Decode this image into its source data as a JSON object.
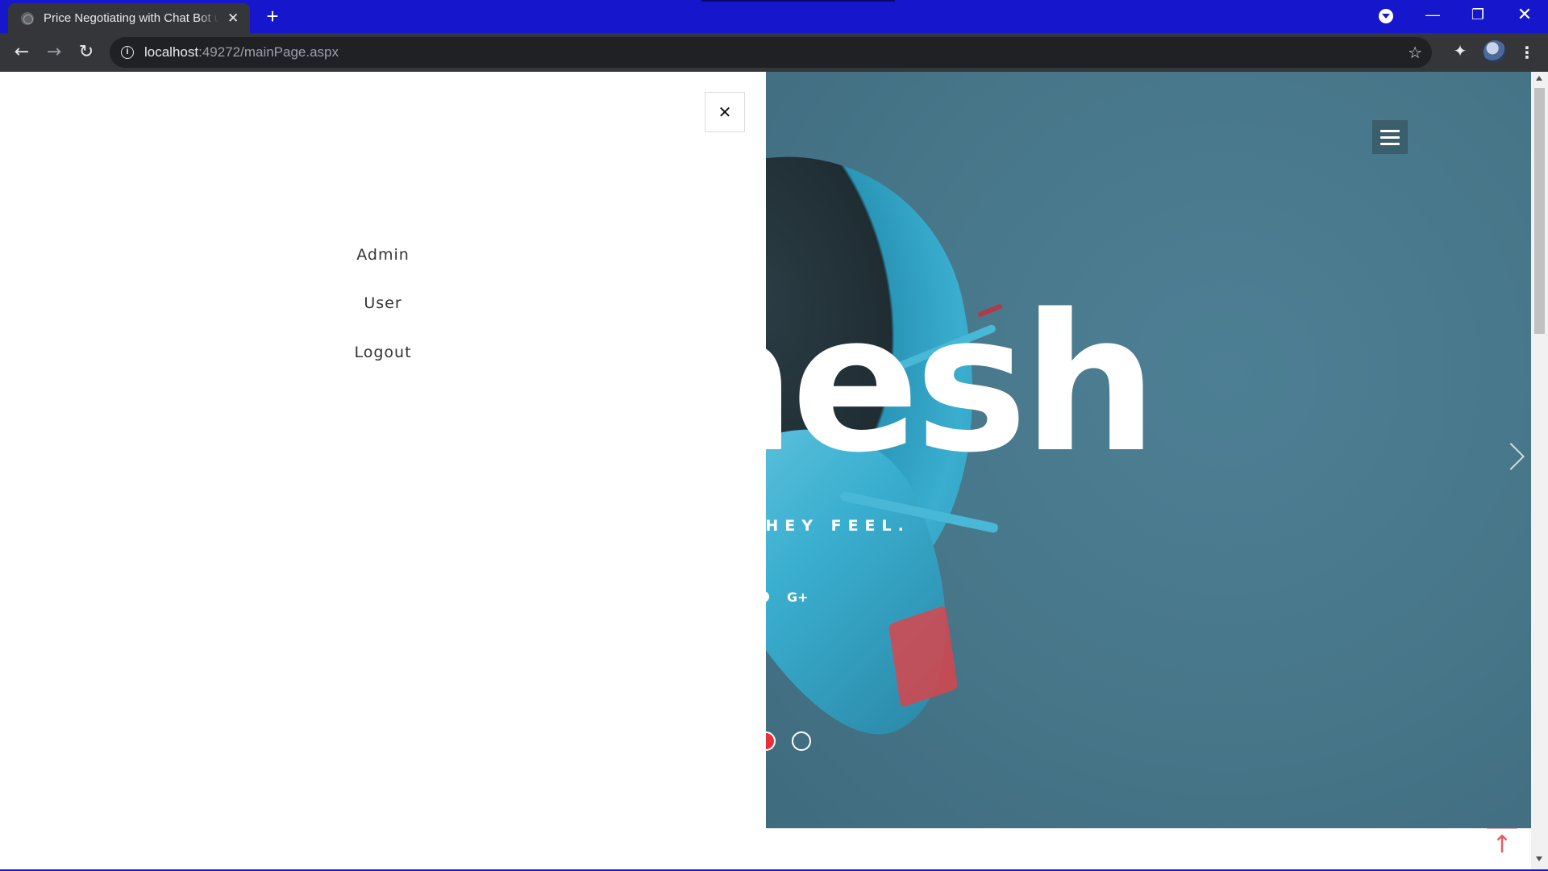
{
  "browser": {
    "tab_title": "Price Negotiating with Chat Bot using...",
    "tab_close": "✕",
    "new_tab": "+",
    "url_host": "localhost",
    "url_rest": ":49272/mainPage.aspx",
    "window_minimize": "—",
    "window_maximize": "❐",
    "window_close": "✕",
    "back": "←",
    "forward": "→",
    "reload": "↻",
    "info": "i",
    "bookmark_star": "☆",
    "extensions": "✦",
    "menu": "⋮"
  },
  "side_menu": {
    "close_label": "✕",
    "items": [
      {
        "label": "Admin"
      },
      {
        "label": "User"
      },
      {
        "label": "Logout"
      }
    ]
  },
  "hero": {
    "headline_fragment": "nesh",
    "subtitle_fragment": "D THEY FEEL.",
    "social_gplus": "G+",
    "slides_total": 2,
    "active_slide": 1
  },
  "page": {
    "back_to_top": "↑"
  },
  "colors": {
    "tabstrip": "#1616cc",
    "hero_bg": "#477689",
    "accent_red": "#e8303a"
  },
  "icons": [
    "globe-favicon-icon",
    "close-icon",
    "plus-icon",
    "back-arrow-icon",
    "forward-arrow-icon",
    "reload-icon",
    "info-icon",
    "star-icon",
    "puzzle-icon",
    "profile-avatar",
    "kebab-menu-icon",
    "hamburger-icon",
    "chevron-right-icon",
    "arrow-up-icon",
    "google-plus-icon"
  ]
}
